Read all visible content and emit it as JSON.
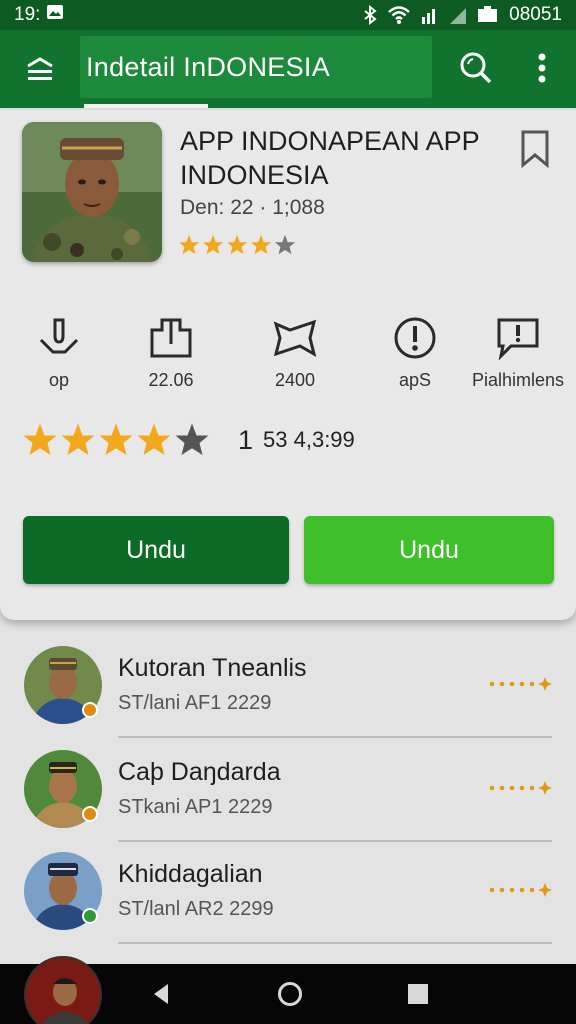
{
  "status_bar": {
    "time": "19:",
    "clock": "08051"
  },
  "app_bar": {
    "search_text": "Indetail InDONESIA"
  },
  "app": {
    "title": "APP INDONAPEAN APP INDONESIA",
    "meta": "Den: 22 · 1;088",
    "small_rating": 4
  },
  "info": [
    {
      "icon": "download-icon",
      "label": "op"
    },
    {
      "icon": "size-icon",
      "label": "22.06"
    },
    {
      "icon": "bookmark-outline-icon",
      "label": "2400"
    },
    {
      "icon": "info-icon",
      "label": "apS"
    },
    {
      "icon": "comment-icon",
      "label": "Pialhimlens"
    }
  ],
  "rating": {
    "stars": 4,
    "big_number": "1",
    "text": "53 4,3:99"
  },
  "buttons": {
    "left_label": "Undu",
    "right_label": "Undu"
  },
  "list": [
    {
      "name": "Kutoran Tneanlis",
      "sub": "ST/lani AF1 2229",
      "badge_color": "#e08a14"
    },
    {
      "name": "Caþ Daŋdarda",
      "sub": "STkani AP1 2229",
      "badge_color": "#e08a14"
    },
    {
      "name": "Khiddagalian",
      "sub": "ST/lanl AR2 2299",
      "badge_color": "#2e9a3a"
    }
  ],
  "colors": {
    "status_bar": "#0d5a22",
    "app_bar": "#11742e",
    "button_dark": "#0c6b26",
    "button_light": "#3fbf2a",
    "star": "#f2a81d",
    "star_empty": "#666666"
  }
}
